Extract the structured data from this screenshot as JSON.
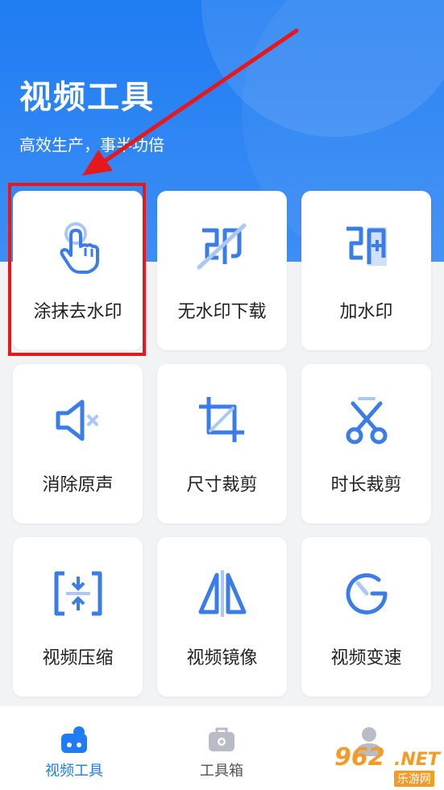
{
  "header": {
    "title": "视频工具",
    "subtitle": "高效生产，事半功倍"
  },
  "tools": [
    {
      "label": "涂抹去水印",
      "icon": "tap-hand-icon"
    },
    {
      "label": "无水印下载",
      "icon": "no-watermark-icon"
    },
    {
      "label": "加水印",
      "icon": "add-watermark-icon"
    },
    {
      "label": "消除原声",
      "icon": "mute-icon"
    },
    {
      "label": "尺寸裁剪",
      "icon": "crop-icon"
    },
    {
      "label": "时长裁剪",
      "icon": "scissors-icon"
    },
    {
      "label": "视频压缩",
      "icon": "compress-icon"
    },
    {
      "label": "视频镜像",
      "icon": "mirror-icon"
    },
    {
      "label": "视频变速",
      "icon": "speed-gauge-icon"
    }
  ],
  "tabs": [
    {
      "label": "视频工具",
      "icon": "video-tools-icon",
      "active": true
    },
    {
      "label": "工具箱",
      "icon": "toolbox-icon",
      "active": false
    },
    {
      "label": "",
      "icon": "profile-icon",
      "active": false
    }
  ],
  "watermark": {
    "number": "962",
    "domain": ".NET",
    "site": "乐游网"
  },
  "colors": {
    "accent": "#1f7cf2",
    "icon_blue": "#3a7de8",
    "icon_light": "#a9c8f7",
    "highlight_red": "#e5191c",
    "inactive_gray": "#b8bcc4"
  }
}
